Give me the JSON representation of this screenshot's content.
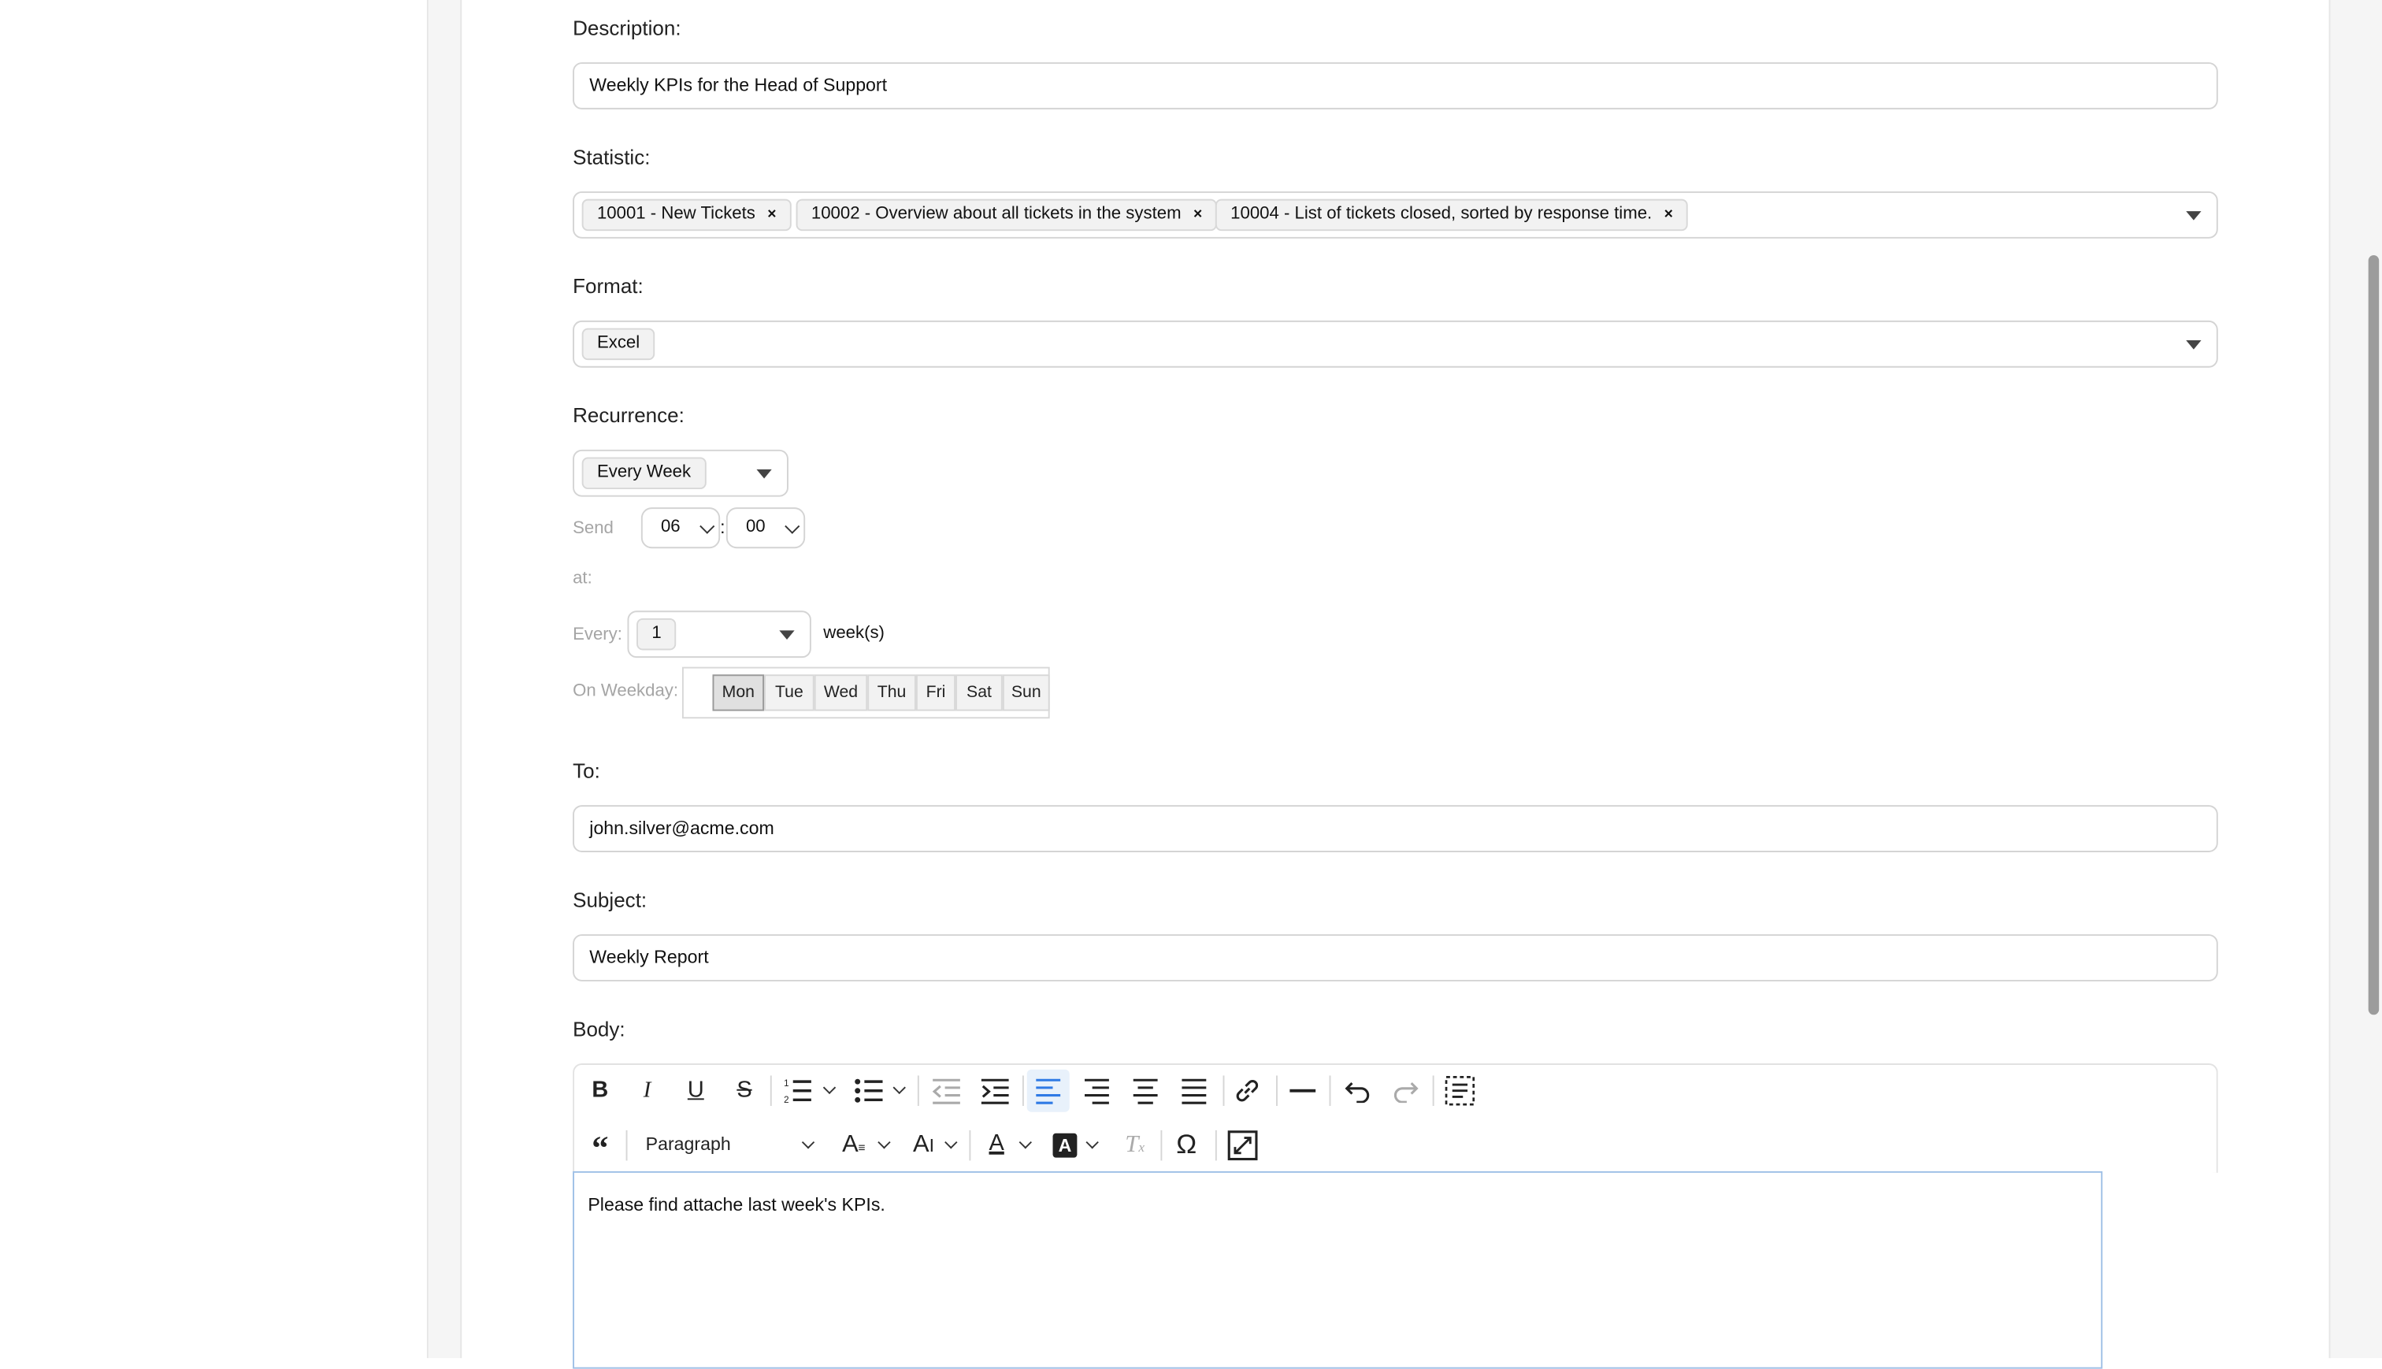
{
  "description": {
    "label": "Description:",
    "value": "Weekly KPIs for the Head of Support"
  },
  "statistic": {
    "label": "Statistic:",
    "tags": [
      "10001 - New Tickets",
      "10002 - Overview about all tickets in the system",
      "10004 - List of tickets closed, sorted by response time."
    ],
    "remove_glyph": "×"
  },
  "format": {
    "label": "Format:",
    "value": "Excel"
  },
  "recurrence": {
    "label": "Recurrence:",
    "value": "Every Week",
    "send_label": "Send",
    "at_label": "at:",
    "hour": "06",
    "minute": "00",
    "time_separator": ":",
    "every_label": "Every:",
    "every_value": "1",
    "every_unit": "week(s)",
    "weekday_label": "On Weekday:",
    "weekdays": [
      "Mon",
      "Tue",
      "Wed",
      "Thu",
      "Fri",
      "Sat",
      "Sun"
    ],
    "selected_weekday": "Mon"
  },
  "to": {
    "label": "To:",
    "value": "john.silver@acme.com"
  },
  "subject": {
    "label": "Subject:",
    "value": "Weekly Report"
  },
  "body": {
    "label": "Body:",
    "paragraph_style": "Paragraph",
    "content": "Please find attache last week's KPIs."
  },
  "colors": {
    "accent": "#2f7ae5",
    "border": "#d4d4d4",
    "muted_text": "#a5a5a5"
  }
}
